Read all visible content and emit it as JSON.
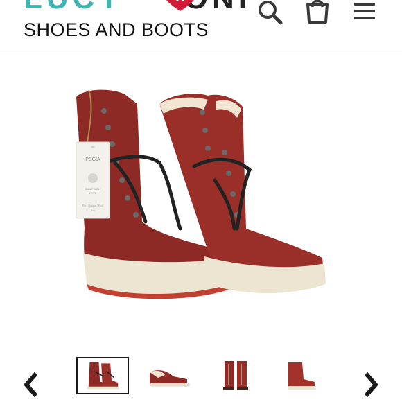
{
  "header": {
    "logo_top_left": "LUCY",
    "logo_top_right": "ONI",
    "logo_subtitle": "SHOES AND BOOTS",
    "icons": [
      "search-icon",
      "cart-icon",
      "menu-icon"
    ]
  },
  "product": {
    "tag_brand": "PEGIA",
    "tag_line1": "BUILT WITH",
    "tag_line2": "LOVE",
    "tag_line3": "Pure Natural Wool",
    "tag_line4": "Fur"
  },
  "gallery": {
    "prev_icon": "chevron-left-icon",
    "next_icon": "chevron-right-icon",
    "active_index": 0,
    "thumbnails": [
      "boots-front-pair",
      "boot-side-fur",
      "boots-back-pair",
      "boot-side-red"
    ]
  },
  "colors": {
    "teal": "#3fb4b0",
    "boot_red": "#8e2a25",
    "sole": "#ece5d2",
    "heart_red": "#d21b36"
  }
}
